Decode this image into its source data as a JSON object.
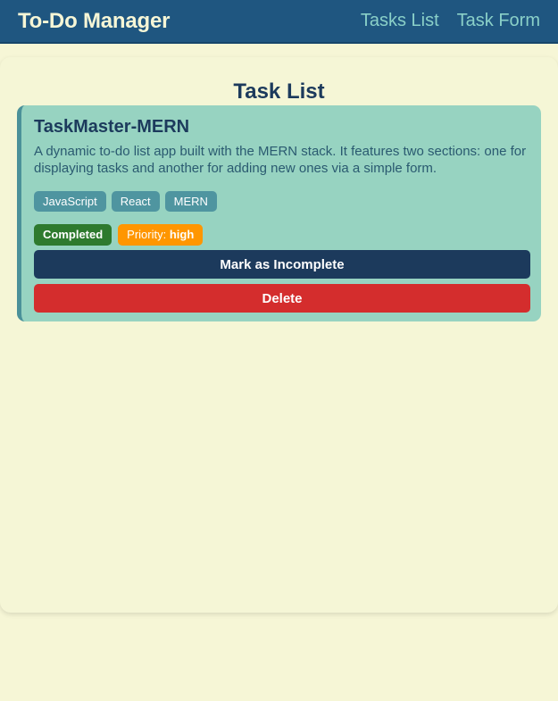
{
  "navbar": {
    "brand": "To-Do Manager",
    "links": [
      "Tasks List",
      "Task Form"
    ]
  },
  "page": {
    "title": "Task List"
  },
  "task": {
    "title": "TaskMaster-MERN",
    "description": "A dynamic to-do list app built with the MERN stack. It features two sections: one for displaying tasks and another for adding new ones via a simple form.",
    "tags": [
      "JavaScript",
      "React",
      "MERN"
    ],
    "status": "Completed",
    "priority_label": "Priority:",
    "priority_value": "high",
    "toggle_label": "Mark as Incomplete",
    "delete_label": "Delete"
  },
  "colors": {
    "navbar": "#1f5680",
    "background": "#f6f6d6",
    "card": "#97d3c1",
    "tag": "#4f95a0",
    "status_completed": "#2e7a2e",
    "priority_high": "#ff9600",
    "primary_button": "#1c3a5c",
    "danger_button": "#d42d2d"
  }
}
